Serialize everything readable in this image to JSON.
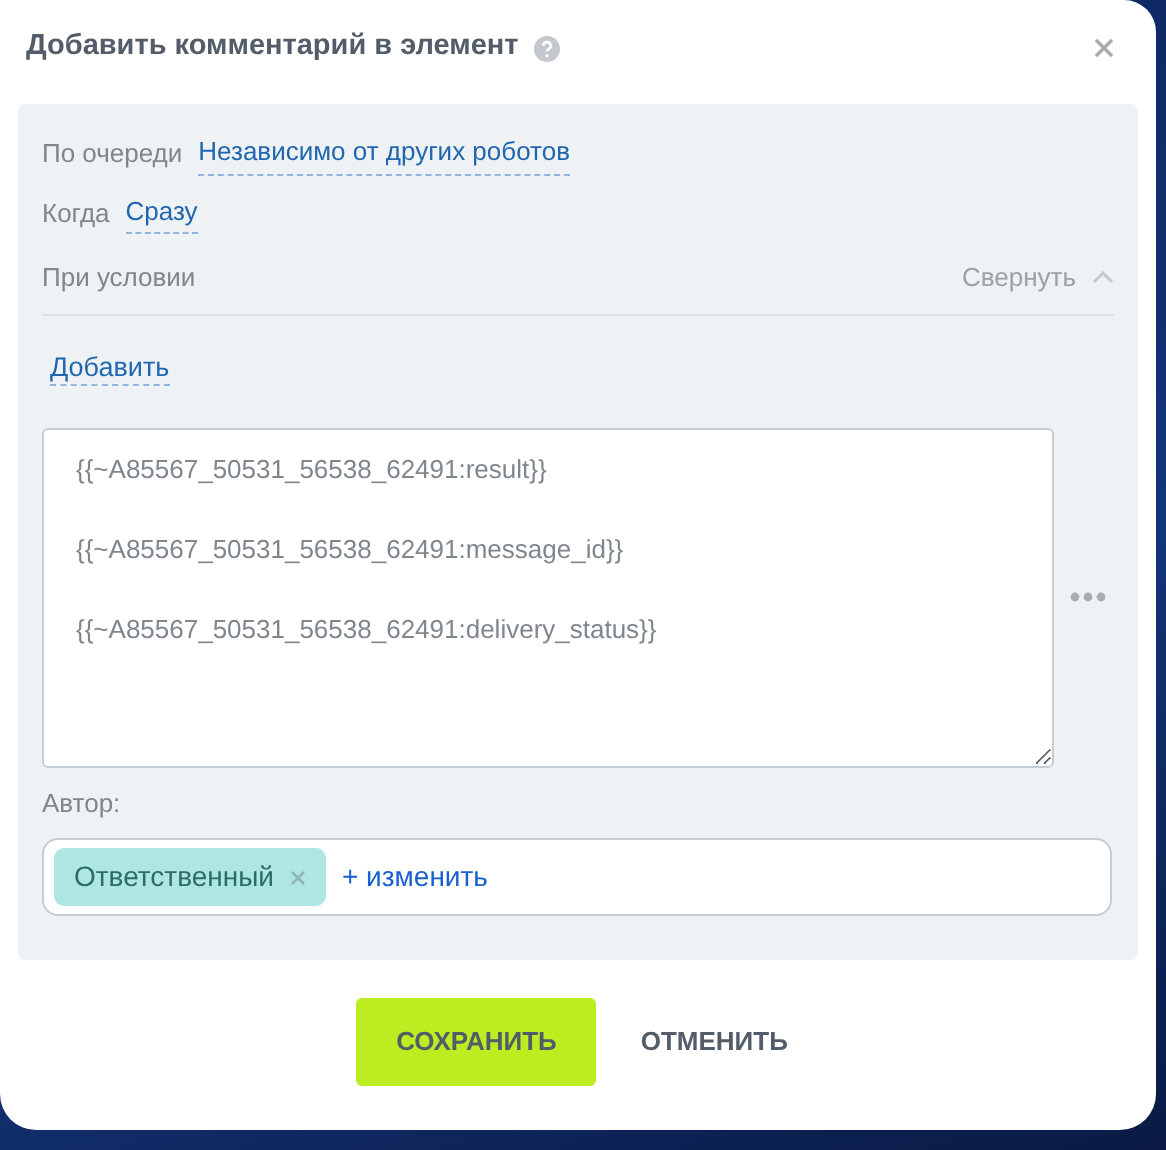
{
  "dialog": {
    "title": "Добавить комментарий в элемент"
  },
  "settings": [
    {
      "label": "По очереди",
      "value": "Независимо от других роботов"
    },
    {
      "label": "Когда",
      "value": "Сразу"
    }
  ],
  "condition": {
    "label": "При условии",
    "collapse": "Свернуть",
    "add_link": "Добавить"
  },
  "comment": {
    "lines": [
      "{{~A85567_50531_56538_62491:result}}",
      "{{~A85567_50531_56538_62491:message_id}}",
      "{{~A85567_50531_56538_62491:delivery_status}}"
    ]
  },
  "author": {
    "label": "Автор:",
    "tags": [
      {
        "text": "Ответственный"
      }
    ],
    "change_link": "+ изменить"
  },
  "buttons": [
    {
      "kind": "primary",
      "label": "СОХРАНИТЬ"
    },
    {
      "kind": "link",
      "label": "ОТМЕНИТЬ"
    }
  ]
}
